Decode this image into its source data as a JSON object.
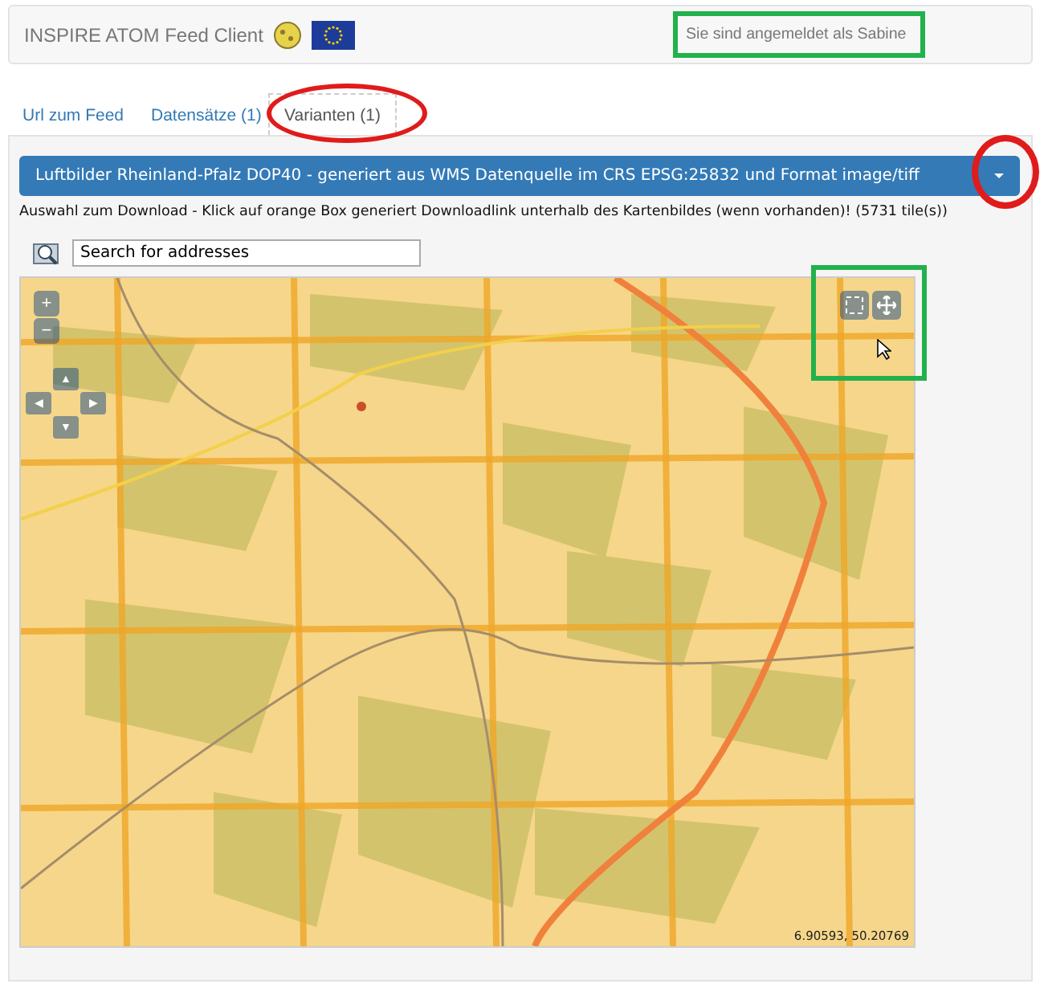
{
  "header": {
    "title": "INSPIRE ATOM Feed Client",
    "login": "Sie sind angemeldet als Sabine"
  },
  "tabs": [
    {
      "label": "Url zum Feed",
      "selected": false
    },
    {
      "label": "Datensätze (1)",
      "selected": false
    },
    {
      "label": "Varianten (1)",
      "selected": true
    }
  ],
  "variant_select": {
    "value": "Luftbilder Rheinland-Pfalz DOP40 - generiert aus WMS Datenquelle im CRS EPSG:25832 und Format image/tiff"
  },
  "instruction": "Auswahl zum Download - Klick auf orange Box generiert Downloadlink unterhalb des Kartenbildes (wenn vorhanden)! (5731 tile(s))",
  "search": {
    "value": "Search for addresses"
  },
  "map": {
    "zoom_controls": [
      "+",
      "−"
    ],
    "pan_controls": [
      "▲",
      "◀",
      "▶",
      "▼"
    ],
    "coordinates": "6.90593, 50.20769"
  }
}
